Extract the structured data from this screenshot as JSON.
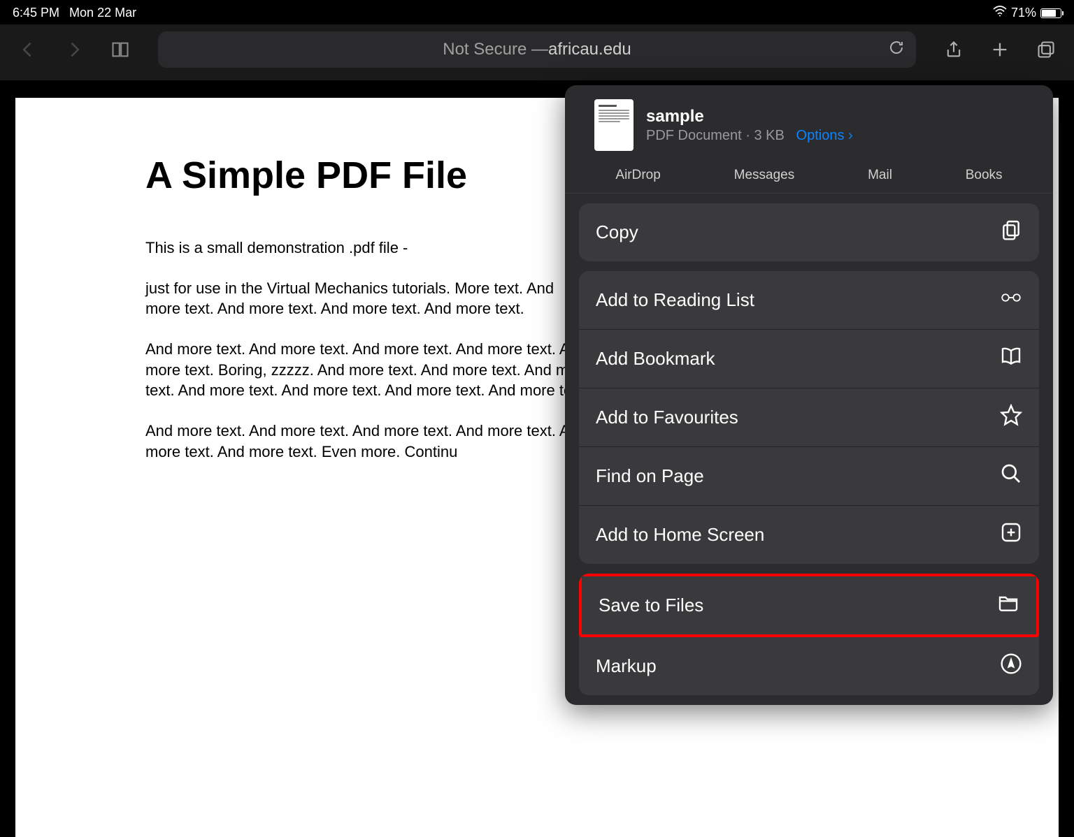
{
  "status": {
    "time": "6:45 PM",
    "date": "Mon 22 Mar",
    "battery_pct": "71%"
  },
  "toolbar": {
    "url_not_secure": "Not Secure — ",
    "url_domain": "africau.edu"
  },
  "pdf": {
    "title": "A Simple PDF File",
    "p1": "This is a small demonstration .pdf file -",
    "p2": "just for use in the Virtual Mechanics tutorials. More text. And more text. And more text. And more text. And more text.",
    "p3": "And more text. And more text. And more text. And more text. And more text. Boring, zzzzz. And more text. And more text. And more text. And more text. And more text. And more text. And more text.",
    "p4": "And more text. And more text. And more text. And more text. And more text. And more text. Even more. Continu"
  },
  "share": {
    "file_title": "sample",
    "file_subtitle": "PDF Document · 3 KB",
    "options": "Options",
    "apps": {
      "airdrop": "AirDrop",
      "messages": "Messages",
      "mail": "Mail",
      "books": "Books"
    },
    "actions": {
      "copy": "Copy",
      "reading_list": "Add to Reading List",
      "bookmark": "Add Bookmark",
      "favourites": "Add to Favourites",
      "find": "Find on Page",
      "homescreen": "Add to Home Screen",
      "save_files": "Save to Files",
      "markup": "Markup"
    }
  }
}
